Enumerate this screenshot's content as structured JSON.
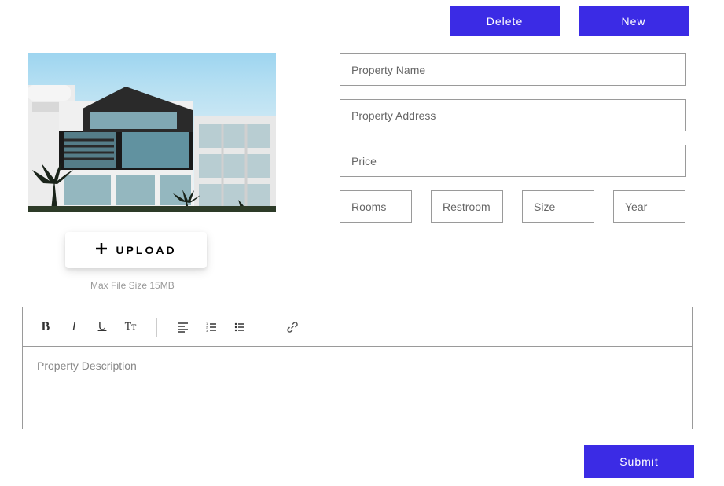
{
  "buttons": {
    "delete": "Delete",
    "new": "New",
    "upload": "UPLOAD",
    "submit": "Submit"
  },
  "upload": {
    "hint": "Max File Size 15MB"
  },
  "fields": {
    "name": {
      "placeholder": "Property Name",
      "value": ""
    },
    "address": {
      "placeholder": "Property Address",
      "value": ""
    },
    "price": {
      "placeholder": "Price",
      "value": ""
    },
    "rooms": {
      "placeholder": "Rooms",
      "value": ""
    },
    "restrooms": {
      "placeholder": "Restrooms",
      "value": ""
    },
    "size": {
      "placeholder": "Size",
      "value": ""
    },
    "year": {
      "placeholder": "Year",
      "value": ""
    }
  },
  "editor": {
    "placeholder": "Property Description",
    "toolbar": {
      "bold": "B",
      "italic": "I",
      "underline": "U",
      "textsize": "Tᴛ"
    }
  }
}
